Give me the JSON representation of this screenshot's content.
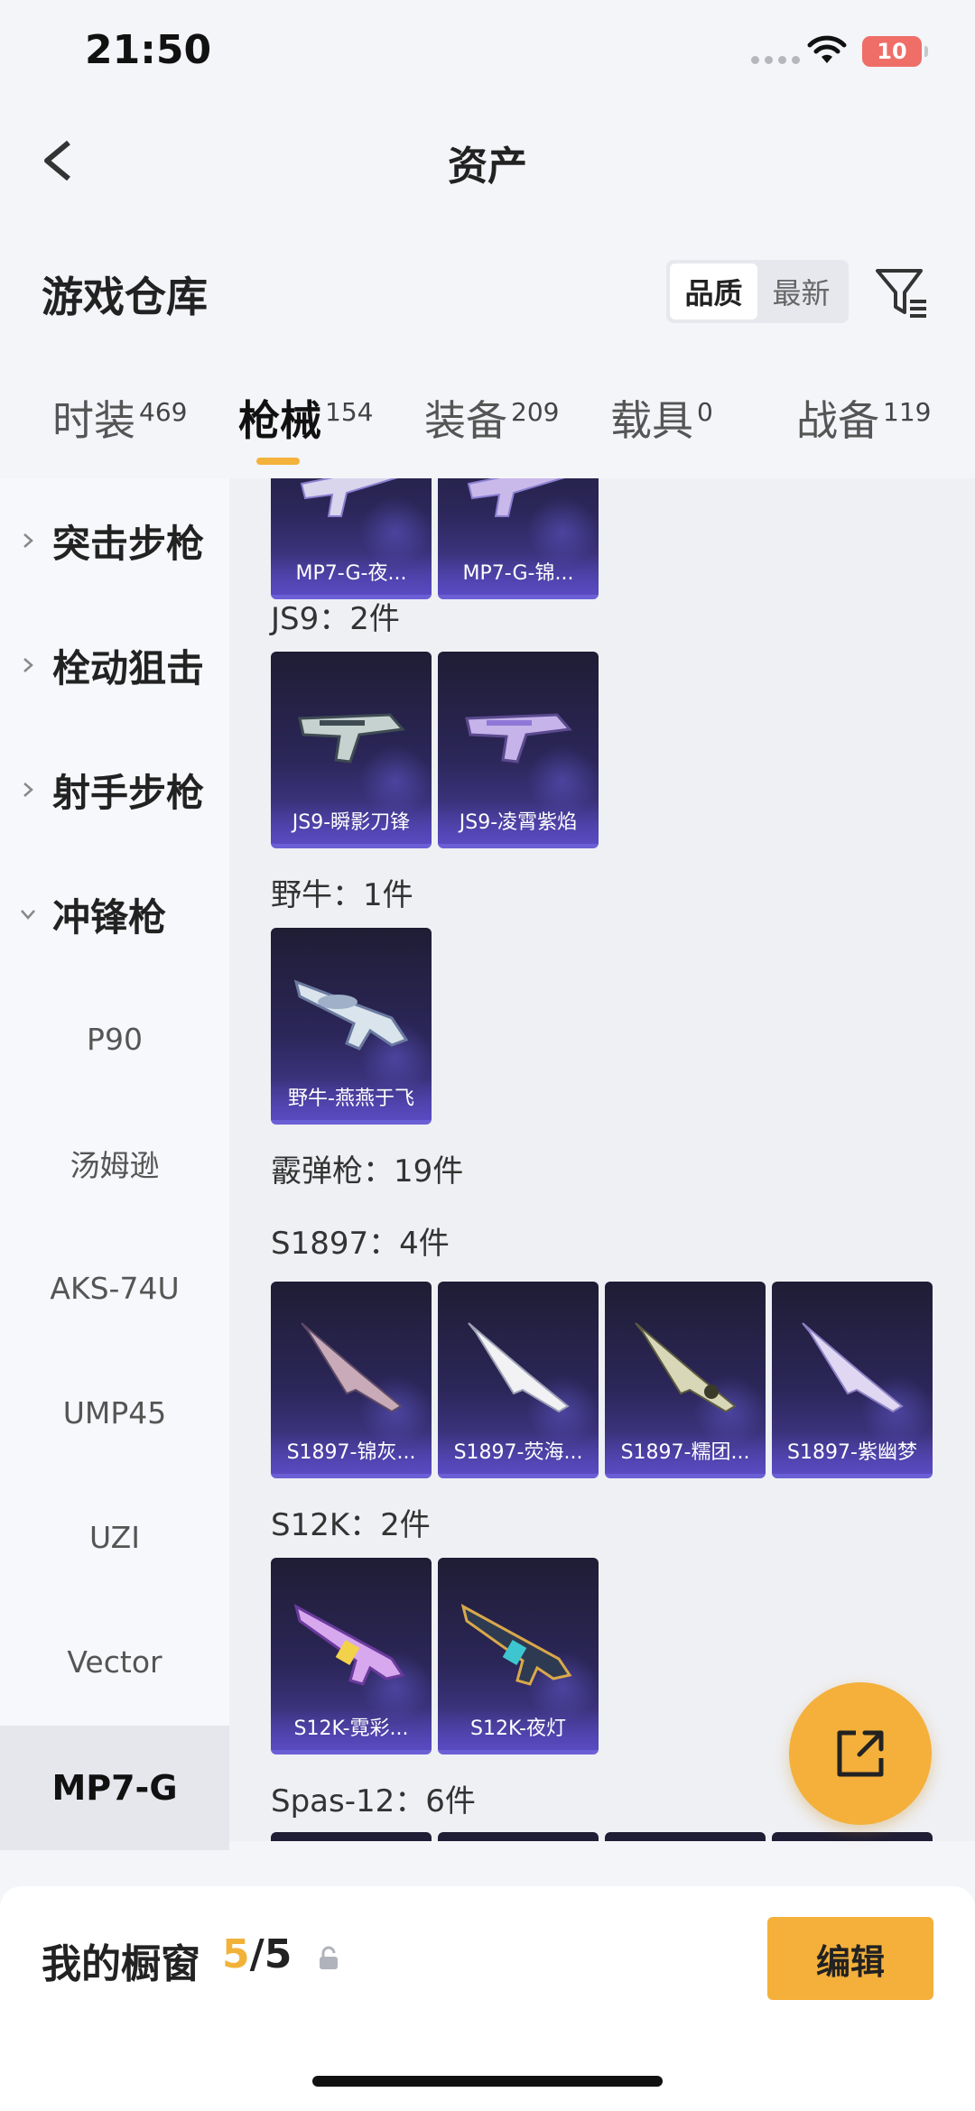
{
  "status": {
    "time": "21:50",
    "battery": "10"
  },
  "nav": {
    "title": "资产",
    "back_icon": "chevron-left-icon"
  },
  "warehouse": {
    "title": "游戏仓库",
    "sort_options": [
      "品质",
      "最新"
    ],
    "sort_active": "品质",
    "filter_icon": "filter-icon"
  },
  "tabs": [
    {
      "label": "时装",
      "count": "469"
    },
    {
      "label": "枪械",
      "count": "154"
    },
    {
      "label": "装备",
      "count": "209"
    },
    {
      "label": "载具",
      "count": "0"
    },
    {
      "label": "战备",
      "count": "119"
    }
  ],
  "active_tab": "枪械",
  "sidebar": {
    "groups": [
      "突击步枪",
      "栓动狙击",
      "射手步枪",
      "冲锋枪"
    ],
    "items": [
      "P90",
      "汤姆逊",
      "AKS-74U",
      "UMP45",
      "UZI",
      "Vector",
      "MP7-G"
    ],
    "active_item": "MP7-G"
  },
  "content": {
    "mp7_cards": [
      "MP7-G-夜...",
      "MP7-G-锦..."
    ],
    "js9": {
      "title": "JS9：2件",
      "cards": [
        "JS9-瞬影刀锋",
        "JS9-凌霄紫焰"
      ]
    },
    "yeniu": {
      "title": "野牛：1件",
      "cards": [
        "野牛-燕燕于飞"
      ]
    },
    "shotgun_title": "霰弹枪：19件",
    "s1897": {
      "title": "S1897：4件",
      "cards": [
        "S1897-锦灰...",
        "S1897-荧海...",
        "S1897-糯团...",
        "S1897-紫幽梦"
      ]
    },
    "s12k": {
      "title": "S12K：2件",
      "cards": [
        "S12K-霓彩...",
        "S12K-夜灯"
      ]
    },
    "spas": {
      "title": "Spas-12：6件"
    }
  },
  "showcase": {
    "title": "我的橱窗",
    "count_current": "5",
    "count_total": "/5",
    "edit_label": "编辑"
  },
  "colors": {
    "accent": "#f4b03a",
    "card_bg": "#2b2658",
    "card_border": "#6b5fd6"
  }
}
